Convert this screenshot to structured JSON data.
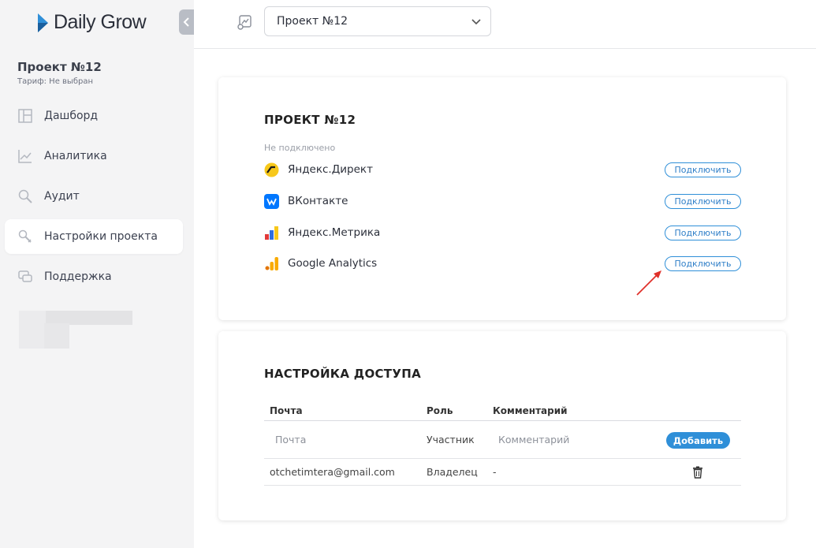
{
  "app": {
    "logo_text": "Daily Grow"
  },
  "sidebar": {
    "project_name": "Проект №12",
    "tariff": "Тариф: Не выбран",
    "items": [
      {
        "label": "Дашборд",
        "icon": "dashboard-icon",
        "active": false
      },
      {
        "label": "Аналитика",
        "icon": "chart-line-icon",
        "active": false
      },
      {
        "label": "Аудит",
        "icon": "magnifier-icon",
        "active": false
      },
      {
        "label": "Настройки проекта",
        "icon": "settings-wrench-icon",
        "active": true
      },
      {
        "label": "Поддержка",
        "icon": "chat-icon",
        "active": false
      }
    ]
  },
  "topbar": {
    "project_selected": "Проект №12"
  },
  "integrations": {
    "title": "ПРОЕКТ №12",
    "status": "Не подключено",
    "connect_label": "Подключить",
    "services": [
      {
        "name": "Яндекс.Директ",
        "icon": "yandex-direct-icon"
      },
      {
        "name": "ВКонтакте",
        "icon": "vk-icon"
      },
      {
        "name": "Яндекс.Метрика",
        "icon": "yandex-metrika-icon"
      },
      {
        "name": "Google Analytics",
        "icon": "google-analytics-icon"
      }
    ]
  },
  "access": {
    "title": "НАСТРОЙКА ДОСТУПА",
    "columns": {
      "email": "Почта",
      "role": "Роль",
      "comment": "Комментарий"
    },
    "new_row": {
      "email_placeholder": "Почта",
      "role": "Участник",
      "comment_placeholder": "Комментарий",
      "add_label": "Добавить"
    },
    "rows": [
      {
        "email": "otchetimtera@gmail.com",
        "role": "Владелец",
        "comment": "-"
      }
    ]
  },
  "colors": {
    "accent": "#2f8fd8",
    "sidebar_bg": "#f4f4f5",
    "arrow": "#e0312a"
  }
}
